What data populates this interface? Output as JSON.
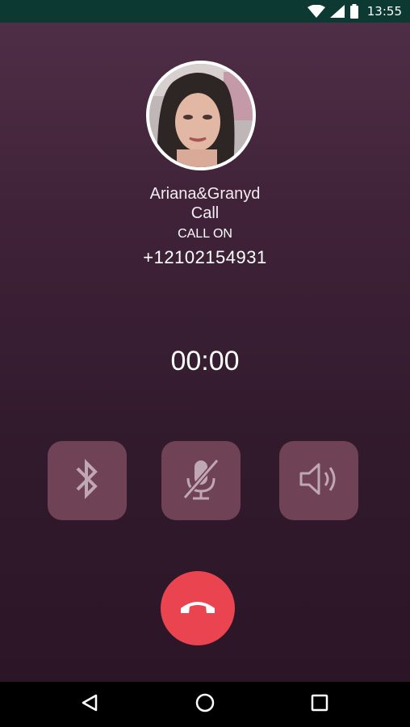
{
  "status_bar": {
    "time": "13:55",
    "icons": [
      "wifi-icon",
      "signal-icon",
      "battery-icon"
    ]
  },
  "contact": {
    "name_line1": "Ariana&Granyd",
    "name_line2": "Call",
    "call_status": "CALL ON",
    "phone_number": "+12102154931"
  },
  "call": {
    "timer": "00:00"
  },
  "controls": {
    "icons": [
      "bluetooth-icon",
      "mute-microphone-icon",
      "speaker-icon",
      "end-call-icon"
    ]
  },
  "navigation": {
    "icons": [
      "back-icon",
      "home-icon",
      "recents-icon"
    ]
  },
  "colors": {
    "status_bar_bg": "#0c3a33",
    "screen_top": "#4e2e46",
    "screen_bottom": "#2b1526",
    "control_bg": "#6f4256",
    "hangup_red": "#ea4450"
  }
}
